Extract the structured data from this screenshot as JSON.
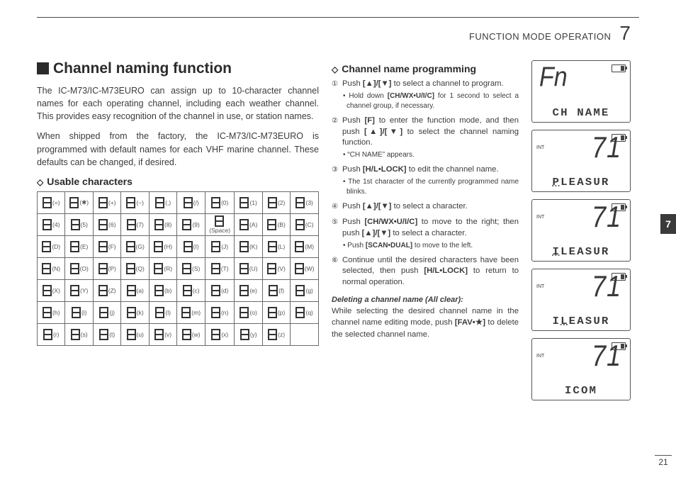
{
  "header": {
    "title": "FUNCTION MODE OPERATION",
    "chapter": "7"
  },
  "side_tab": "7",
  "page_number": "21",
  "section_title": "Channel naming function",
  "intro_p1": "The IC-M73/IC-M73EURO can assign up to 10-character channel names for each operating channel, including each weather channel. This provides easy recognition of the channel in use, or station names.",
  "intro_p2": "When shipped from the factory, the IC-M73/IC-M73EURO is programmed with default names for each VHF marine channel. These defaults can be changed, if desired.",
  "usable_heading": "Usable characters",
  "char_table": [
    [
      "(=)",
      "(✱)",
      "(+)",
      "(−)",
      "(,)",
      "(/)",
      "(0)",
      "(1)",
      "(2)",
      "(3)"
    ],
    [
      "(4)",
      "(5)",
      "(6)",
      "(7)",
      "(8)",
      "(9)",
      "(Space)",
      "(A)",
      "(B)",
      "(C)"
    ],
    [
      "(D)",
      "(E)",
      "(F)",
      "(G)",
      "(H)",
      "(I)",
      "(J)",
      "(K)",
      "(L)",
      "(M)"
    ],
    [
      "(N)",
      "(O)",
      "(P)",
      "(Q)",
      "(R)",
      "(S)",
      "(T)",
      "(U)",
      "(V)",
      "(W)"
    ],
    [
      "(X)",
      "(Y)",
      "(Z)",
      "(a)",
      "(b)",
      "(c)",
      "(d)",
      "(e)",
      "(f)",
      "(g)"
    ],
    [
      "(h)",
      "(i)",
      "(j)",
      "(k)",
      "(l)",
      "(m)",
      "(n)",
      "(o)",
      "(p)",
      "(q)"
    ],
    [
      "(r)",
      "(s)",
      "(t)",
      "(u)",
      "(v)",
      "(w)",
      "(x)",
      "(y)",
      "(z)",
      ""
    ]
  ],
  "prog_heading": "Channel name programming",
  "steps": [
    {
      "n": "①",
      "html": "Push <b>[▲]/[▼]</b> to select a channel to program.",
      "note": "• Hold down <b>[CH/WX•U/I/C]</b> for 1 second to select a channel group, if necessary."
    },
    {
      "n": "②",
      "html": "Push <b>[F]</b> to enter the function mode, and then push <b>[▲]/[▼]</b> to select the channel naming function.",
      "note": "• “CH NAME” appears."
    },
    {
      "n": "③",
      "html": "Push <b>[H/L•LOCK]</b> to edit the channel name.",
      "note": "• The 1st character of the currently programmed name blinks."
    },
    {
      "n": "④",
      "html": "Push <b>[▲]/[▼]</b> to select a character.",
      "note": ""
    },
    {
      "n": "⑤",
      "html": "Push <b>[CH/WX•U/I/C]</b> to move to the right; then push <b>[▲]/[▼]</b> to select a character.",
      "note": "• Push <b>[SCAN•DUAL]</b> to move to the left."
    },
    {
      "n": "⑥",
      "html": "Continue until the desired characters have been selected, then push <b>[H/L•LOCK]</b> to return to normal operation.",
      "note": ""
    }
  ],
  "delete_heading": "Deleting a channel name (All clear):",
  "delete_body": "While selecting the desired channel name in the channel name editing mode, push <b>[FAV•★]</b> to delete the selected channel name.",
  "lcds": [
    {
      "big": "Fn",
      "tag": "",
      "bottom": "CH NAME",
      "bigAlign": "left"
    },
    {
      "big": "71",
      "tag": "INT",
      "bottom": "PLEASUR",
      "blinkIndex": 0
    },
    {
      "big": "71",
      "tag": "INT",
      "bottom": "ILEASUR",
      "blinkIndex": 0
    },
    {
      "big": "71",
      "tag": "INT",
      "bottom": "ILEASUR",
      "blinkIndex": 1
    },
    {
      "big": "71",
      "tag": "INT",
      "bottom": "ICOM"
    }
  ]
}
